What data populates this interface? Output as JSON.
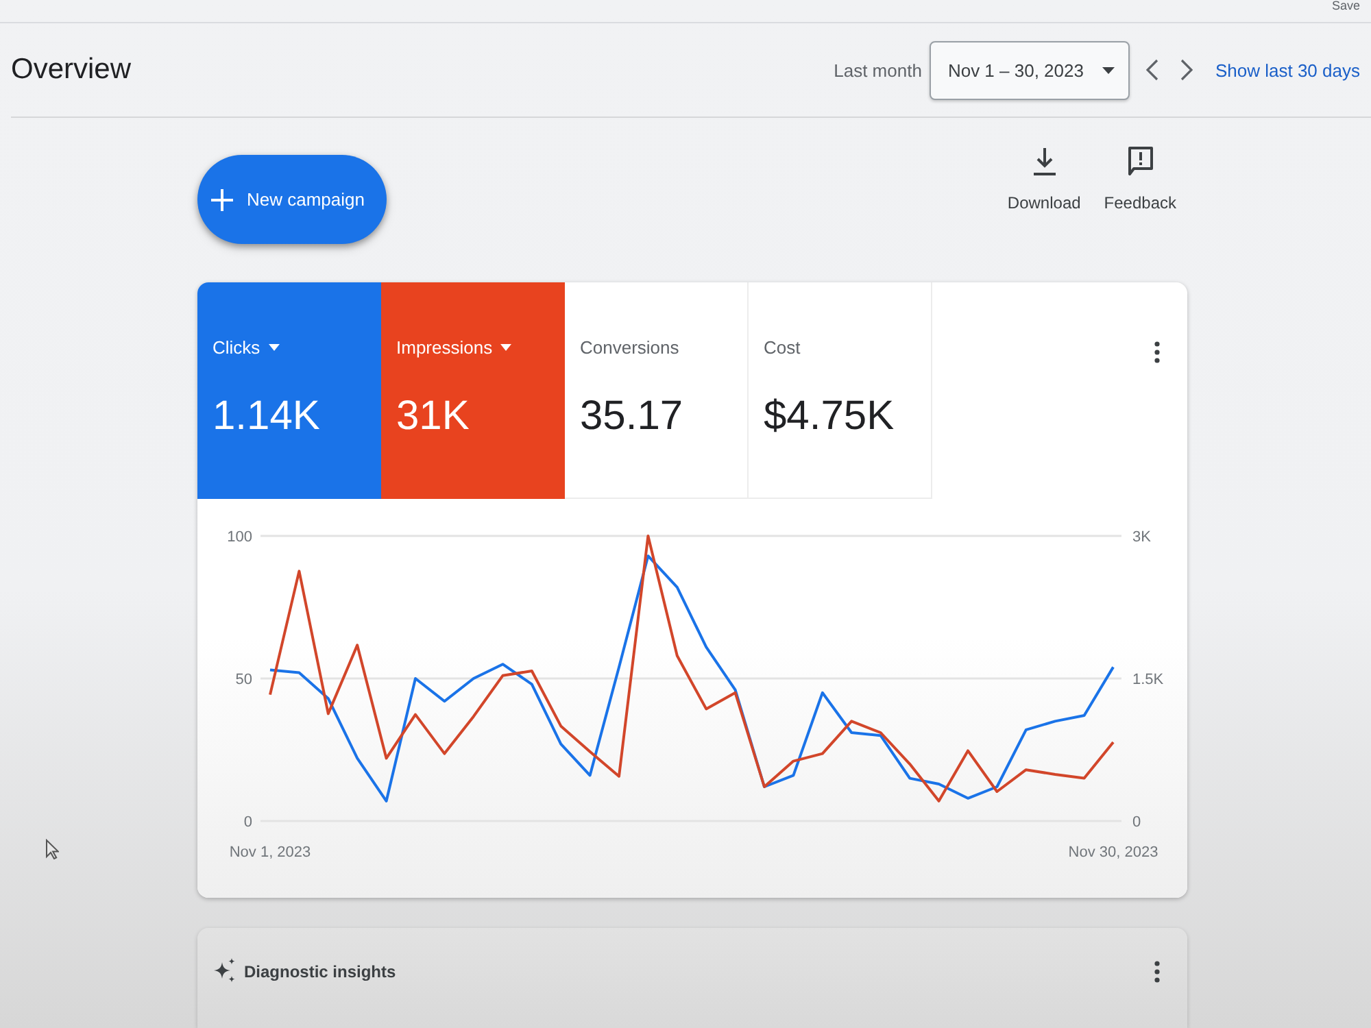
{
  "top_bar": {
    "cut_text": "Save"
  },
  "header": {
    "title": "Overview",
    "range_label": "Last month",
    "date_range": {
      "value": "Nov 1 – 30, 2023"
    },
    "link": "Show last 30 days"
  },
  "actions": {
    "new_button": "New campaign",
    "tools": [
      {
        "kind": "download",
        "label": "Download"
      },
      {
        "kind": "feedback",
        "label": "Feedback"
      }
    ]
  },
  "performance_card": {
    "metrics": [
      {
        "label": "Clicks",
        "value": "1.14K",
        "selected": true,
        "color": "#1a73e8"
      },
      {
        "label": "Impressions",
        "value": "31K",
        "selected": true,
        "color": "#e8431f"
      },
      {
        "label": "Conversions",
        "value": "35.17",
        "selected": false
      },
      {
        "label": "Cost",
        "value": "$4.75K",
        "selected": false
      }
    ],
    "chart_data": {
      "type": "line",
      "categories": [
        "Nov 1, 2023",
        null,
        null,
        null,
        null,
        null,
        null,
        null,
        null,
        null,
        null,
        null,
        null,
        null,
        null,
        null,
        null,
        null,
        null,
        null,
        null,
        null,
        null,
        null,
        null,
        null,
        null,
        null,
        null,
        "Nov 30, 2023"
      ],
      "ylim": [
        0,
        100
      ],
      "yticks": [
        0,
        50,
        100
      ],
      "y2lim": [
        0,
        3000
      ],
      "y2ticks": [
        {
          "value": 0,
          "label": "0"
        },
        {
          "value": 1500,
          "label": "1.5K"
        },
        {
          "value": 3000,
          "label": "3K"
        }
      ],
      "series": [
        {
          "color": "#1a73e8",
          "axis": "y",
          "values": [
            53,
            52,
            43,
            22,
            7,
            50,
            42,
            50,
            55,
            48,
            27,
            16,
            54,
            93,
            82,
            61,
            46,
            12,
            16,
            45,
            31,
            30,
            15,
            13,
            8,
            12,
            32,
            35,
            37,
            54
          ]
        },
        {
          "color": "#d2462a",
          "axis": "y2",
          "values": [
            1330,
            2630,
            1130,
            1850,
            660,
            1120,
            710,
            1100,
            1530,
            1580,
            1000,
            730,
            470,
            3000,
            1740,
            1180,
            1350,
            360,
            630,
            710,
            1050,
            930,
            600,
            210,
            740,
            310,
            540,
            490,
            450,
            830
          ]
        }
      ]
    }
  },
  "insights_card": {
    "title": "Diagnostic insights"
  }
}
